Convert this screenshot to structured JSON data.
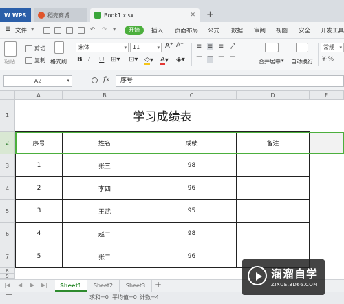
{
  "tabs": {
    "wps": "WPS",
    "daoke": "稻壳商城",
    "book": "Book1.xlsx"
  },
  "menu": {
    "file": "文件",
    "start": "开始",
    "items": [
      "插入",
      "页面布局",
      "公式",
      "数据",
      "审阅",
      "视图",
      "安全",
      "开发工具"
    ]
  },
  "ribbon": {
    "paste": "粘贴",
    "cut": "剪切",
    "copy": "复制",
    "format_painter": "格式刷",
    "font_name": "宋体",
    "font_size": "11",
    "merge": "合并居中",
    "wrap": "自动换行",
    "number_format": "常规"
  },
  "formula_bar": {
    "cell_ref": "A2",
    "fx": "fx",
    "value": "序号"
  },
  "columns": [
    "A",
    "B",
    "C",
    "D",
    "E"
  ],
  "rows": [
    "1",
    "2",
    "3",
    "4",
    "5",
    "6",
    "7",
    "8",
    "9"
  ],
  "sheet": {
    "title": "学习成绩表",
    "headers": [
      "序号",
      "姓名",
      "成绩",
      "备注"
    ],
    "data": [
      [
        "1",
        "张三",
        "98",
        ""
      ],
      [
        "2",
        "李四",
        "96",
        ""
      ],
      [
        "3",
        "王武",
        "95",
        ""
      ],
      [
        "4",
        "赵二",
        "98",
        ""
      ],
      [
        "5",
        "张二",
        "96",
        ""
      ]
    ]
  },
  "sheet_tabs": [
    "Sheet1",
    "Sheet2",
    "Sheet3"
  ],
  "status": {
    "sum": "求和=0",
    "avg": "平均值=0",
    "count": "计数=4"
  },
  "watermark": {
    "name": "溜溜自学",
    "url": "ZIXUE.3D66.COM"
  },
  "colors": {
    "accent": "#4caf3d",
    "wps_blue": "#2b5fa9"
  }
}
